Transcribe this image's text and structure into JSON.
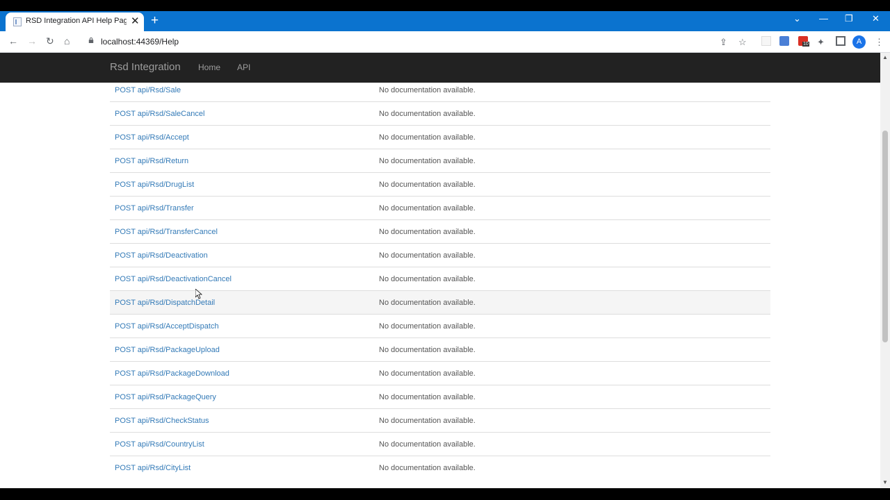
{
  "browser": {
    "tab_title": "RSD Integration API Help Page -",
    "tab_close_symbol": "✕",
    "new_tab_symbol": "+",
    "url": "localhost:44369/Help",
    "avatar_letter": "A",
    "extension_badge": "10",
    "accent_color": "#0b73cf"
  },
  "navbar": {
    "brand": "Rsd Integration",
    "links": [
      "Home",
      "API"
    ]
  },
  "apis": [
    {
      "api": "POST api/Rsd/Sale",
      "description": "No documentation available."
    },
    {
      "api": "POST api/Rsd/SaleCancel",
      "description": "No documentation available."
    },
    {
      "api": "POST api/Rsd/Accept",
      "description": "No documentation available."
    },
    {
      "api": "POST api/Rsd/Return",
      "description": "No documentation available."
    },
    {
      "api": "POST api/Rsd/DrugList",
      "description": "No documentation available."
    },
    {
      "api": "POST api/Rsd/Transfer",
      "description": "No documentation available."
    },
    {
      "api": "POST api/Rsd/TransferCancel",
      "description": "No documentation available."
    },
    {
      "api": "POST api/Rsd/Deactivation",
      "description": "No documentation available."
    },
    {
      "api": "POST api/Rsd/DeactivationCancel",
      "description": "No documentation available."
    },
    {
      "api": "POST api/Rsd/DispatchDetail",
      "description": "No documentation available."
    },
    {
      "api": "POST api/Rsd/AcceptDispatch",
      "description": "No documentation available."
    },
    {
      "api": "POST api/Rsd/PackageUpload",
      "description": "No documentation available."
    },
    {
      "api": "POST api/Rsd/PackageDownload",
      "description": "No documentation available."
    },
    {
      "api": "POST api/Rsd/PackageQuery",
      "description": "No documentation available."
    },
    {
      "api": "POST api/Rsd/CheckStatus",
      "description": "No documentation available."
    },
    {
      "api": "POST api/Rsd/CountryList",
      "description": "No documentation available."
    },
    {
      "api": "POST api/Rsd/CityList",
      "description": "No documentation available."
    }
  ],
  "hovered_row_index": 9
}
